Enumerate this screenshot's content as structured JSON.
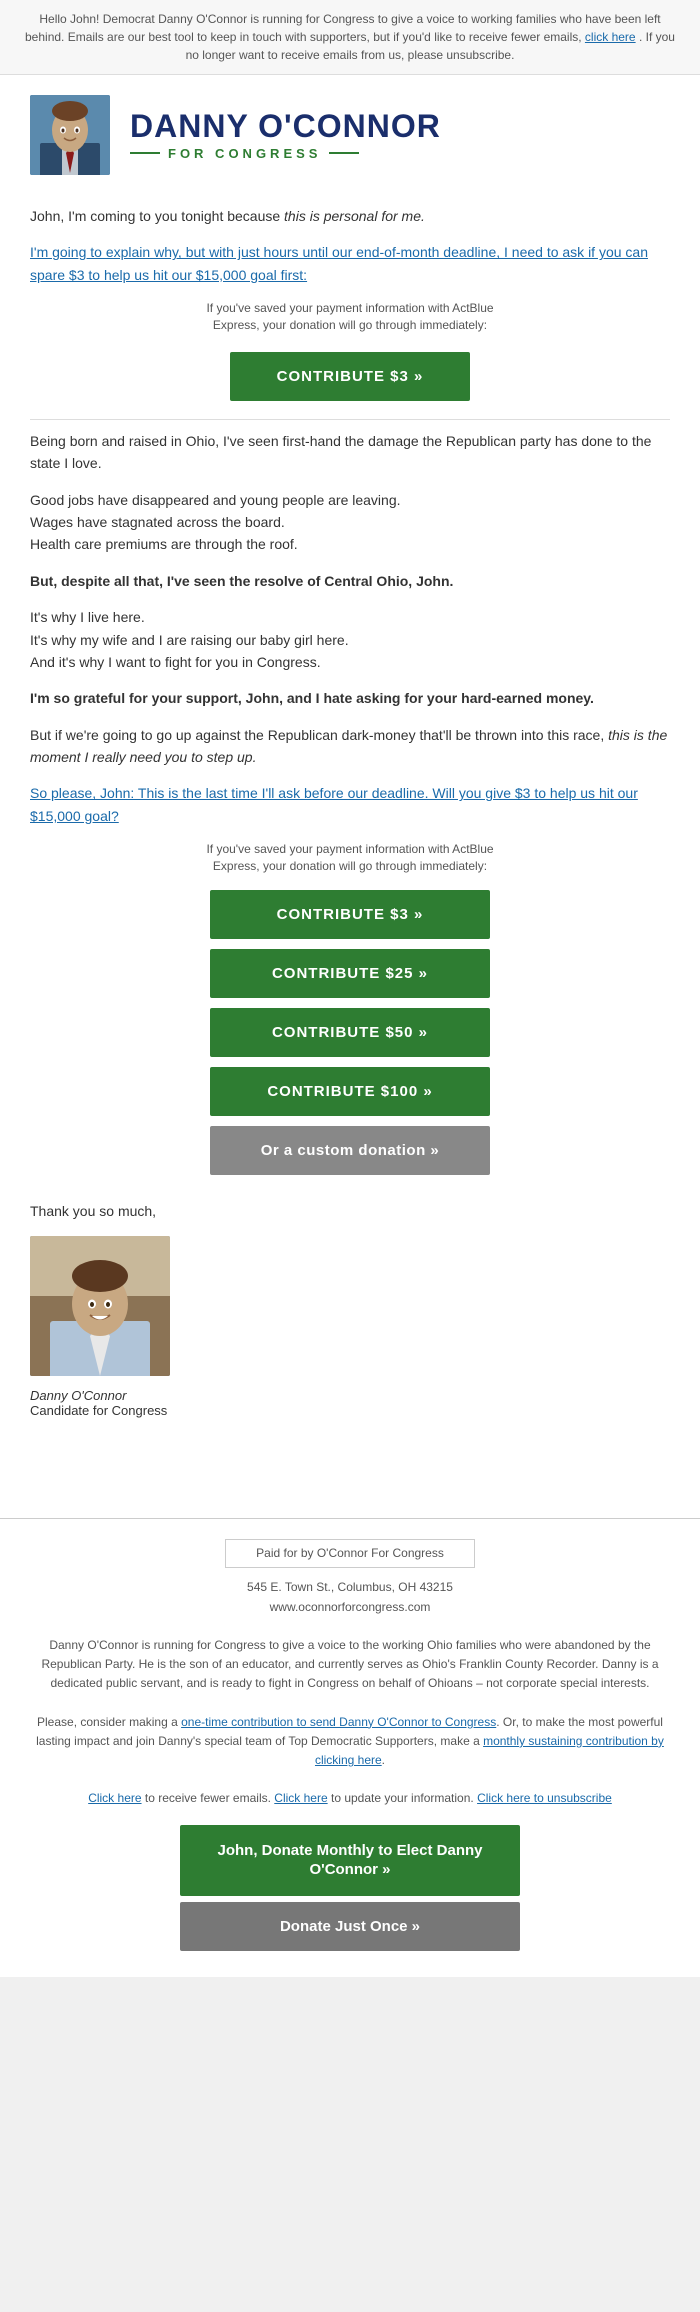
{
  "topbar": {
    "text": "Hello John! Democrat Danny O'Connor is running for Congress to give a voice to working families who have been left behind. Emails are our best tool to keep in touch with supporters, but if you'd like to receive fewer emails, ",
    "click_here": "click here",
    "unsubscribe_text": ". If you no longer want to receive emails from us, please unsubscribe."
  },
  "header": {
    "name": "DANNY O'CONNOR",
    "tagline": "FOR CONGRESS"
  },
  "body": {
    "intro": "John, I'm coming to you tonight because ",
    "intro_italic": "this is personal for me.",
    "link_text": "I'm going to explain why, but with just hours until our end-of-month deadline, I need to ask if you can spare $3 to help us hit our $15,000 goal first:",
    "actblue_note": "If you've saved your payment information with ActBlue Express, your donation will go through immediately:",
    "contribute_3_label": "CONTRIBUTE $3 »",
    "paragraph1": "Being born and raised in Ohio, I've seen first-hand the damage the Republican party has done to the state I love.",
    "paragraph2a": "Good jobs have disappeared and young people are leaving.",
    "paragraph2b": "Wages have stagnated across the board.",
    "paragraph2c": "Health care premiums are through the roof.",
    "paragraph3": "But, despite all that, I've seen the resolve of Central Ohio, John.",
    "paragraph4a": "It's why I live here.",
    "paragraph4b": "It's why my wife and I are raising our baby girl here.",
    "paragraph4c": "And it's why I want to fight for you in Congress.",
    "paragraph5": "I'm so grateful for your support, John, and I hate asking for your hard-earned money.",
    "paragraph6_start": "But if we're going to go up against the Republican dark-money that'll be thrown into this race, ",
    "paragraph6_italic": "this is the moment I really need you to step up.",
    "link2_text": "So please, John: This is the last time I'll ask before our deadline. Will you give $3 to help us hit our $15,000 goal?",
    "actblue_note2": "If you've saved your payment information with ActBlue Express, your donation will go through immediately:",
    "contribute_3_label2": "CONTRIBUTE $3 »",
    "contribute_25_label": "CONTRIBUTE $25 »",
    "contribute_50_label": "CONTRIBUTE $50 »",
    "contribute_100_label": "CONTRIBUTE $100 »",
    "custom_label": "Or a custom donation »",
    "thank_you": "Thank you so much,",
    "signature_name": "Danny O'Connor",
    "signature_title": "Candidate for Congress"
  },
  "footer": {
    "paid_for": "Paid for by O'Connor For Congress",
    "address": "545 E. Town St., Columbus, OH 43215",
    "website": "www.oconnorforcongress.com",
    "disclaimer": "Danny O'Connor is running for Congress to give a voice to the working Ohio families who were abandoned by the Republican Party. He is the son of an educator, and currently serves as Ohio's Franklin County Recorder. Danny is a dedicated public servant, and is ready to fight in Congress on behalf of Ohioans – not corporate special interests.",
    "one_time_text": "Please, consider making a ",
    "one_time_link": "one-time contribution to send Danny O'Connor to Congress",
    "or_text": ". Or, to make the most powerful lasting impact and join Danny's special team of Top Democratic Supporters, make a ",
    "monthly_link": "monthly sustaining contribution by clicking here",
    "end_period": ".",
    "fewer_emails": "Click here",
    "fewer_emails_text": " to receive fewer emails. ",
    "update_link": "Click here",
    "update_text": " to update your information. ",
    "unsubscribe_link": "Click here to unsubscribe",
    "btn_monthly": "John, Donate Monthly to Elect\nDanny O'Connor »",
    "btn_once": "Donate Just Once »"
  }
}
